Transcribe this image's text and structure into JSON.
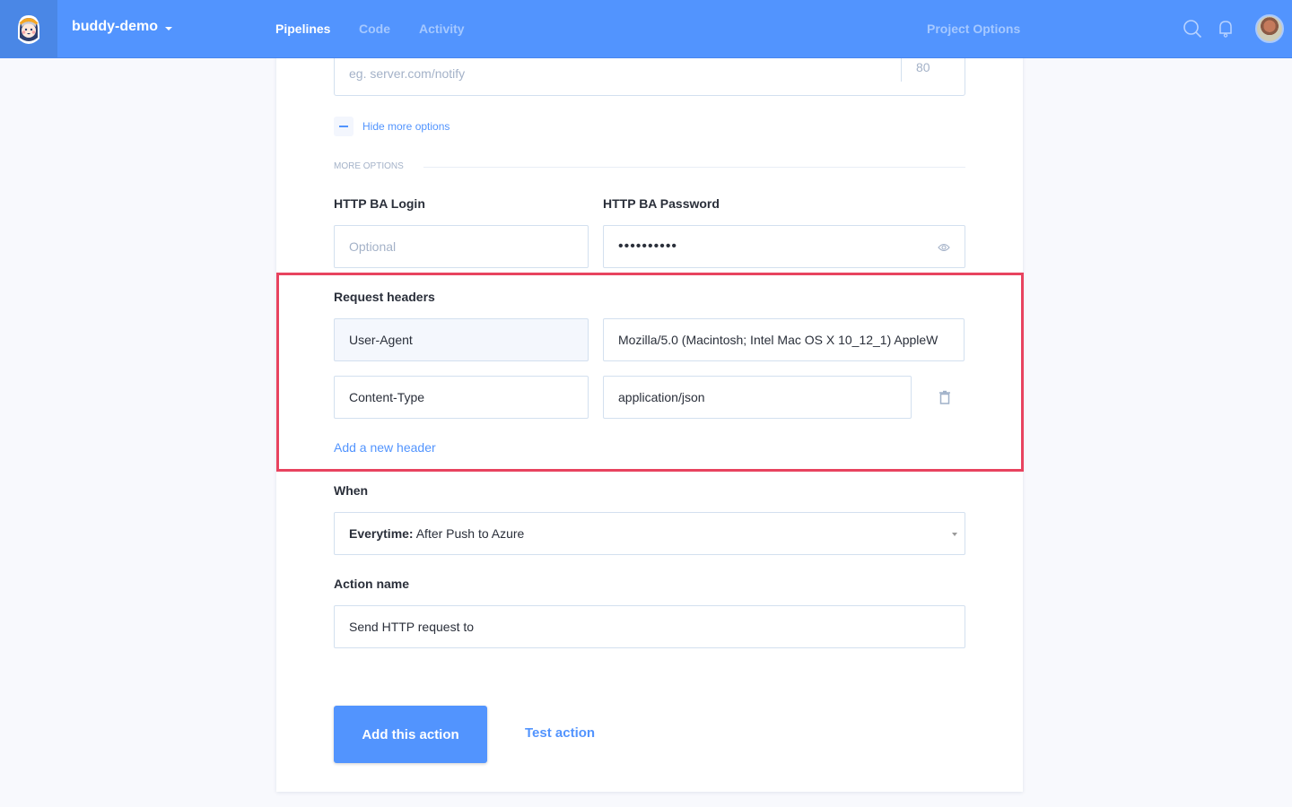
{
  "topbar": {
    "project_name": "buddy-demo",
    "nav": [
      {
        "label": "Pipelines",
        "active": true
      },
      {
        "label": "Code",
        "active": false
      },
      {
        "label": "Activity",
        "active": false
      }
    ],
    "project_options": "Project Options",
    "icons": [
      "logo-mascot-icon",
      "search-icon",
      "bell-icon",
      "user-avatar"
    ],
    "accent_color": "#5294fe"
  },
  "form": {
    "url_input": {
      "placeholder": "eg. server.com/notify",
      "port_placeholder": "80"
    },
    "hide_more_options": "Hide more options",
    "more_options_title": "MORE OPTIONS",
    "http_ba_login": {
      "label": "HTTP BA Login",
      "placeholder": "Optional",
      "value": ""
    },
    "http_ba_password": {
      "label": "HTTP BA Password",
      "value": "••••••••••"
    },
    "request_headers": {
      "label": "Request headers",
      "rows": [
        {
          "name": "User-Agent",
          "value": "Mozilla/5.0 (Macintosh; Intel Mac OS X 10_12_1) AppleW"
        },
        {
          "name": "Content-Type",
          "value": "application/json"
        }
      ],
      "add_link": "Add a new header"
    },
    "when": {
      "label": "When",
      "value_bold": "Everytime:",
      "value_rest": " After Push to Azure"
    },
    "action_name": {
      "label": "Action name",
      "value": "Send HTTP request to"
    },
    "buttons": {
      "primary": "Add this action",
      "secondary": "Test action"
    }
  },
  "highlight_color": "#e8435f"
}
